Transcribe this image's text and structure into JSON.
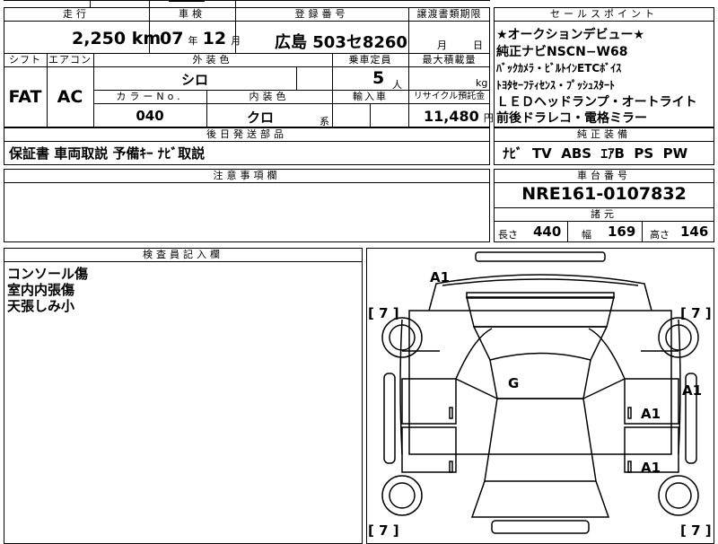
{
  "header": {
    "mileage_label": "走行",
    "inspection_label": "車検",
    "registration_label": "登録番号",
    "transfer_docs_label": "譲渡書類期限",
    "selling_points_label": "セールスポイント"
  },
  "vehicle": {
    "mileage": "2,250",
    "mileage_unit": "km",
    "inspection_year": "07",
    "year_unit": "年",
    "inspection_month": "12",
    "month_unit": "月",
    "plate": "広島 503セ8260",
    "transfer_month_unit": "月",
    "transfer_day_unit": "日",
    "shift": "FAT",
    "aircon": "AC",
    "exterior_color": "シロ",
    "capacity": "5",
    "capacity_unit": "人",
    "max_load_unit": "kg",
    "color_no": "040",
    "interior_color": "クロ",
    "interior_suffix": "系",
    "recycle_fee": "11,480",
    "recycle_unit": "円"
  },
  "labels": {
    "shift": "シフト",
    "aircon": "エアコン",
    "exterior_color": "外装色",
    "capacity": "乗車定員",
    "max_load": "最大積載量",
    "color_no": "カラーNo.",
    "interior_color": "内装色",
    "import": "輸入車",
    "recycle": "リサイクル預託金",
    "accessories": "後日発送部品",
    "oem_equipment": "純正装備",
    "notes": "注意事項欄",
    "chassis": "車台番号",
    "specs": "諸元",
    "inspector": "検査員記入欄"
  },
  "selling_points": [
    "★オークションデビュー★",
    "純正ナビNSCN−W68",
    "ﾊﾞｯｸｶﾒﾗ・ﾋﾞﾙﾄｲﾝETCﾎﾞｲｽ",
    "ﾄﾖﾀｾｰﾌﾃｨｾﾝｽ・ﾌﾟｯｼｭｽﾀｰﾄ",
    "ＬＥＤヘッドランプ・オートライト",
    "前後ドラレコ・電格ミラー"
  ],
  "accessories_text": "保証書 車両取説 予備ｷｰ ﾅﾋﾞ取説",
  "oem_equipment_text": "ﾅﾋﾞ  TV  ABS  ｴｱB  PS  PW",
  "chassis_number": "NRE161-0107832",
  "specs": {
    "length_label": "長さ",
    "length": "440",
    "width_label": "幅",
    "width": "169",
    "height_label": "高さ",
    "height": "146"
  },
  "inspector_notes": [
    "コンソール傷",
    "室内内張傷",
    "天張しみ小"
  ],
  "damage_map": {
    "front": "A1",
    "roof": "G",
    "right_side": "A1",
    "right_front_door": "A1",
    "right_rear_door": "A1",
    "tire_front_left": "7",
    "tire_front_right": "7",
    "tire_rear_left": "7",
    "tire_rear_right": "7"
  }
}
